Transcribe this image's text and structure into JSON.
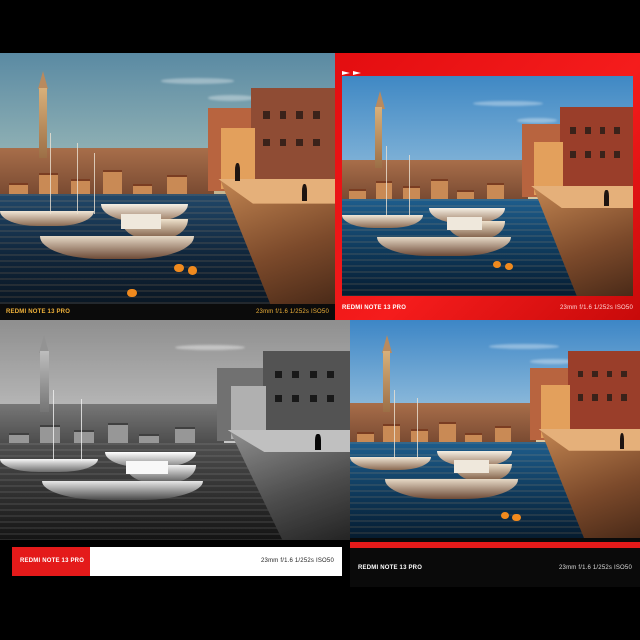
{
  "panels": [
    {
      "brand": "REDMI NOTE 13 PRO",
      "specs": "23mm  f/1.6  1/252s  ISO50"
    },
    {
      "brand": "REDMI NOTE 13 PRO",
      "specs": "23mm  f/1.6  1/252s  ISO50"
    },
    {
      "brand": "REDMI NOTE 13 PRO",
      "specs": "23mm  f/1.6  1/252s  ISO50"
    },
    {
      "brand": "REDMI NOTE 13 PRO",
      "specs": "23mm  f/1.6  1/252s  ISO50"
    }
  ],
  "colors": {
    "accent_red": "#e41a1a",
    "caption_gold": "#f0b23a"
  },
  "icons": [
    "play-arrow-icon",
    "play-arrow-icon"
  ]
}
